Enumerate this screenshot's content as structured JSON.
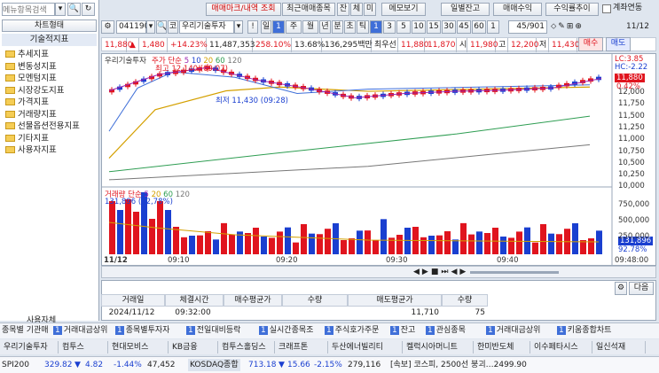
{
  "left_panel": {
    "search_placeholder": "메뉴항목검색",
    "chart_type_tab": "차트형태",
    "section_title": "기술적지표",
    "items": [
      {
        "label": "추세지표"
      },
      {
        "label": "변동성지표"
      },
      {
        "label": "모멘텀지표"
      },
      {
        "label": "시장강도지표"
      },
      {
        "label": "가격지표"
      },
      {
        "label": "거래량지표"
      },
      {
        "label": "선물옵션전용지표"
      },
      {
        "label": "기타지표"
      },
      {
        "label": "사용자지표"
      }
    ],
    "bottom_label": "사용자체"
  },
  "toolbar": {
    "mark_label": "매매마크/내역 조회",
    "recent_label": "최근매매종목",
    "tabs": [
      "잔",
      "체",
      "미"
    ],
    "memo_label": "메모보기",
    "balance_label": "일별잔고",
    "profit_label": "매매수익",
    "trend_label": "수익률추이",
    "account_label": "계좌연동"
  },
  "row2": {
    "code": "041190",
    "search_icon": "magnifier",
    "stock_name": "우리기술투자",
    "period_buttons": [
      "일",
      "1",
      "주",
      "월",
      "년",
      "분",
      "초",
      "틱",
      "1",
      "3",
      "5",
      "10",
      "15",
      "30",
      "45",
      "60",
      "1"
    ],
    "page": "45/901",
    "date": "11/12"
  },
  "row3": {
    "price": "11,880",
    "arrow": "▲",
    "change": "1,480",
    "pct": "+14.23%",
    "volume": "11,487,353",
    "vol_pct": "258.10%",
    "rate": "13.68%",
    "amount": "136,295백만",
    "best_label": "최우선",
    "best_ask": "11,880",
    "best_bid": "11,870",
    "high_label": "시",
    "high": "11,980",
    "low_label": "고",
    "low": "12,200",
    "close_label": "저",
    "close": "11,430",
    "buy_label": "매수",
    "sell_label": "매도"
  },
  "chart": {
    "legend_name": "우리기술투자",
    "legend_ma_label": "주가 단순",
    "ma": [
      "5",
      "10",
      "20",
      "60",
      "120"
    ],
    "max_label": "최고 12,140 (09:07)",
    "min_label": "최저 11,430 (09:28)",
    "lc": "LC:3.85",
    "hc": "HC:-2.22",
    "last_price": "11,880",
    "last_pct": "0.42%",
    "price_axis": [
      "12,000",
      "11,750",
      "11,500",
      "11,250",
      "11,000",
      "10,750",
      "10,500",
      "10,250",
      "10,000"
    ],
    "vol_legend": "거래량 단순",
    "vol_ma": [
      "5",
      "20",
      "60",
      "120"
    ],
    "vol_max": "131,896 (92,78%)",
    "vol_axis": [
      "750,000",
      "500,000",
      "250,000"
    ],
    "vol_last": "131,896",
    "vol_last_pct": "92.78%",
    "time_axis": [
      "11/12",
      "09:10",
      "09:20",
      "09:30",
      "09:40",
      "09:48:00"
    ]
  },
  "chart_data": {
    "type": "line",
    "x": [
      "09:00",
      "09:05",
      "09:10",
      "09:15",
      "09:20",
      "09:25",
      "09:30",
      "09:35",
      "09:40",
      "09:45",
      "09:48"
    ],
    "series": [
      {
        "name": "우리기술투자",
        "values": [
          11650,
          11950,
          12080,
          11850,
          11700,
          11520,
          11600,
          11640,
          11660,
          11700,
          11880
        ]
      }
    ],
    "ylim": [
      9900,
      12200
    ]
  },
  "table": {
    "headers": [
      "거래일",
      "체결시간",
      "매수평균가",
      "수량",
      "매도평균가",
      "수량"
    ],
    "row": [
      "2024/11/12",
      "09:32:00",
      "",
      "",
      "11,710",
      "75"
    ],
    "next_label": "다음"
  },
  "taskbar": {
    "items": [
      "종목별 기관매",
      "거래대금상위",
      "종목별투자자",
      "전일대비등락",
      "실시간종목조",
      "주식호가주문",
      "잔고",
      "관심종목",
      "거래대금상위",
      "키움종합차트"
    ],
    "nums": [
      "1",
      "1",
      "1",
      "1",
      "1",
      "1",
      "1",
      "1",
      "1"
    ]
  },
  "ticker_row": {
    "items": [
      "우리기술투자",
      "컴투스",
      "현대모비스",
      "KB금융",
      "컴투스홀딩스",
      "크래프톤",
      "두산에너빌리티",
      "켈럭시아머니트",
      "한미반도체",
      "이수페타시스",
      "일신석재"
    ]
  },
  "status": {
    "kospi_label": "SPI200",
    "kospi": "329.82",
    "kospi_arrow": "▼",
    "kospi_chg": "4.82",
    "kospi_pct": "-1.44%",
    "kospi_vol": "47,452",
    "kosdaq_label": "KOSDAQ종합",
    "kosdaq": "713.18",
    "kosdaq_arrow": "▼",
    "kosdaq_chg": "15.66",
    "kosdaq_pct": "-2.15%",
    "kosdaq_vol": "279,116",
    "news": "[속보] 코스피, 2500선 붕괴…2499.90"
  }
}
